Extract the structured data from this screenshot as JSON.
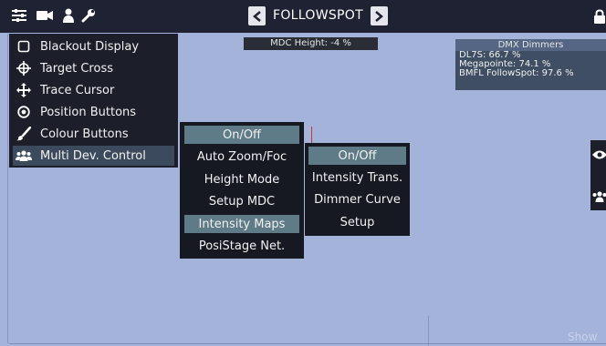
{
  "topbar": {
    "title": "FOLLOWSPOT",
    "icons": [
      "sliders-icon",
      "camera-icon",
      "person-icon",
      "wrench-icon"
    ],
    "prev_icon": "chevron-left-icon",
    "next_icon": "chevron-right-icon",
    "lock_icon": "lock-icon"
  },
  "side_menu": {
    "items": [
      {
        "label": "Blackout Display",
        "icon": "square-icon"
      },
      {
        "label": "Target Cross",
        "icon": "crosshair-icon"
      },
      {
        "label": "Trace Cursor",
        "icon": "move-arrows-icon"
      },
      {
        "label": "Position Buttons",
        "icon": "target-circle-icon"
      },
      {
        "label": "Colour Buttons",
        "icon": "brush-icon"
      },
      {
        "label": "Multi Dev. Control",
        "icon": "group-icon",
        "active": true
      }
    ]
  },
  "mdc_height": {
    "text": "MDC Height: -4 %"
  },
  "dmx_panel": {
    "title": "DMX Dimmers",
    "rows": [
      "DL7S: 66.7 %",
      "Megapointe: 74.1 %",
      "BMFL FollowSpot: 97.6 %"
    ]
  },
  "submenu1": {
    "items": [
      {
        "label": "On/Off",
        "selected": true
      },
      {
        "label": "Auto Zoom/Foc"
      },
      {
        "label": "Height Mode"
      },
      {
        "label": "Setup MDC"
      },
      {
        "label": "Intensity Maps",
        "selected": true
      },
      {
        "label": "PosiStage Net."
      }
    ]
  },
  "submenu2": {
    "items": [
      {
        "label": "On/Off",
        "selected": true
      },
      {
        "label": "Intensity Trans."
      },
      {
        "label": "Dimmer Curve"
      },
      {
        "label": "Setup"
      }
    ]
  },
  "right_strip": {
    "icons": [
      "eye-icon",
      "group-icon"
    ]
  },
  "footer": {
    "show_text": "Show"
  },
  "colors": {
    "background": "#a3b3da",
    "bar": "#1f2233",
    "menu_bg": "#1c1e2a",
    "selected": "#5e7b87",
    "active": "#3b4a5c"
  }
}
